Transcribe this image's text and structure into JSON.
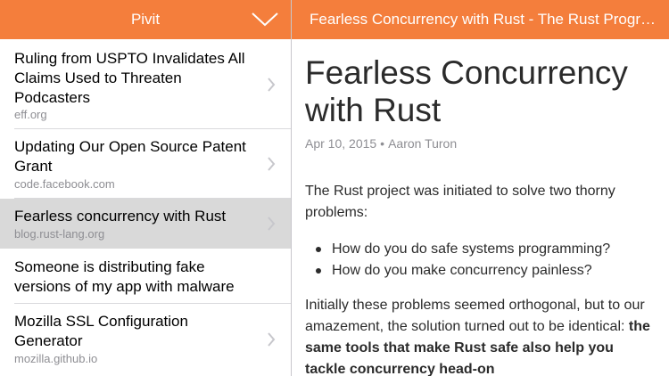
{
  "app": {
    "title": "Pivit",
    "accent_color": "#f47e3c",
    "collapse_icon": "chevron-down-icon"
  },
  "list": {
    "items": [
      {
        "title": "Ruling from USPTO Invalidates All Claims Used to Threaten Podcasters",
        "source": "eff.org",
        "selected": false
      },
      {
        "title": "Updating Our Open Source Patent Grant",
        "source": "code.facebook.com",
        "selected": false
      },
      {
        "title": "Fearless concurrency with Rust",
        "source": "blog.rust-lang.org",
        "selected": true
      },
      {
        "title": "Someone is distributing fake versions of my app with malware",
        "source": "",
        "selected": false
      },
      {
        "title": "Mozilla SSL Configuration Generator",
        "source": "mozilla.github.io",
        "selected": false
      }
    ]
  },
  "article": {
    "header_title": "Fearless Concurrency with Rust - The Rust Progra...",
    "title": "Fearless Concurrency with Rust",
    "date": "Apr 10, 2015",
    "separator": "•",
    "author": "Aaron Turon",
    "intro": "The Rust project was initiated to solve two thorny problems:",
    "bullets": [
      "How do you do safe systems programming?",
      "How do you make concurrency painless?"
    ],
    "para2_plain": "Initially these problems seemed orthogonal, but to our amazement, the solution turned out to be identical: ",
    "para2_bold": "the same tools that make Rust safe also help you tackle concurrency head-on"
  }
}
